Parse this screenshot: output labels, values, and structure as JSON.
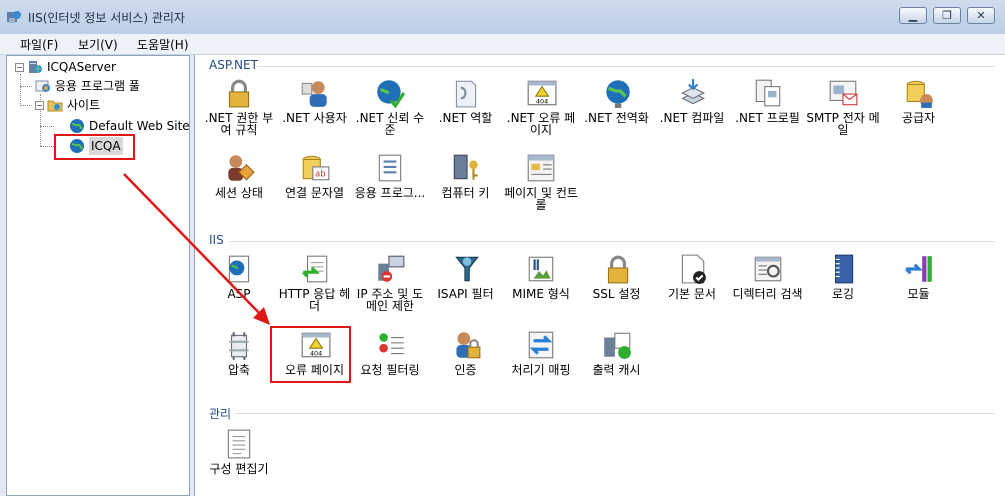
{
  "window": {
    "title": "IIS(인터넷 정보 서비스) 관리자",
    "minimize": "▁",
    "restore": "❐",
    "close": "✕"
  },
  "menu": {
    "file": "파일(F)",
    "view": "보기(V)",
    "help": "도움말(H)"
  },
  "tree": {
    "server": "ICQAServer",
    "app_pools": "응용 프로그램 풀",
    "sites": "사이트",
    "default_site": "Default Web Site",
    "icqa": "ICQA"
  },
  "groups": {
    "aspnet": {
      "title": "ASP.NET",
      "items": [
        {
          "label": ".NET 권한 부여 규칙",
          "icon": "lock-icon"
        },
        {
          "label": ".NET 사용자",
          "icon": "user-icon"
        },
        {
          "label": ".NET 신뢰 수준",
          "icon": "trust-icon"
        },
        {
          "label": ".NET 역할",
          "icon": "role-icon"
        },
        {
          "label": ".NET 오류 페이지",
          "icon": "error-page-icon"
        },
        {
          "label": ".NET 전역화",
          "icon": "globe-icon"
        },
        {
          "label": ".NET 컴파일",
          "icon": "compile-icon"
        },
        {
          "label": ".NET 프로필",
          "icon": "profile-icon"
        },
        {
          "label": "SMTP 전자 메일",
          "icon": "mail-icon"
        },
        {
          "label": "공급자",
          "icon": "provider-icon"
        },
        {
          "label": "세션 상태",
          "icon": "session-icon"
        },
        {
          "label": "연결 문자열",
          "icon": "connection-string-icon"
        },
        {
          "label": "응용 프로그...",
          "icon": "app-settings-icon"
        },
        {
          "label": "컴퓨터 키",
          "icon": "machine-key-icon"
        },
        {
          "label": "페이지 및 컨트롤",
          "icon": "pages-controls-icon"
        }
      ]
    },
    "iis": {
      "title": "IIS",
      "items": [
        {
          "label": "ASP",
          "icon": "asp-icon"
        },
        {
          "label": "HTTP 응답 헤더",
          "icon": "http-headers-icon"
        },
        {
          "label": "IP 주소 및 도메인 제한",
          "icon": "ip-restrict-icon"
        },
        {
          "label": "ISAPI 필터",
          "icon": "isapi-icon"
        },
        {
          "label": "MIME 형식",
          "icon": "mime-icon"
        },
        {
          "label": "SSL 설정",
          "icon": "ssl-lock-icon"
        },
        {
          "label": "기본 문서",
          "icon": "default-doc-icon"
        },
        {
          "label": "디렉터리 검색",
          "icon": "dir-browse-icon"
        },
        {
          "label": "로깅",
          "icon": "logging-icon"
        },
        {
          "label": "모듈",
          "icon": "modules-icon"
        },
        {
          "label": "압축",
          "icon": "compression-icon"
        },
        {
          "label": "오류 페이지",
          "icon": "error-page-icon"
        },
        {
          "label": "요청 필터링",
          "icon": "request-filter-icon"
        },
        {
          "label": "인증",
          "icon": "auth-icon"
        },
        {
          "label": "처리기 매핑",
          "icon": "handler-icon"
        },
        {
          "label": "출력 캐시",
          "icon": "output-cache-icon"
        }
      ]
    },
    "manage": {
      "title": "관리",
      "items": [
        {
          "label": "구성 편집기",
          "icon": "config-editor-icon"
        }
      ]
    }
  }
}
